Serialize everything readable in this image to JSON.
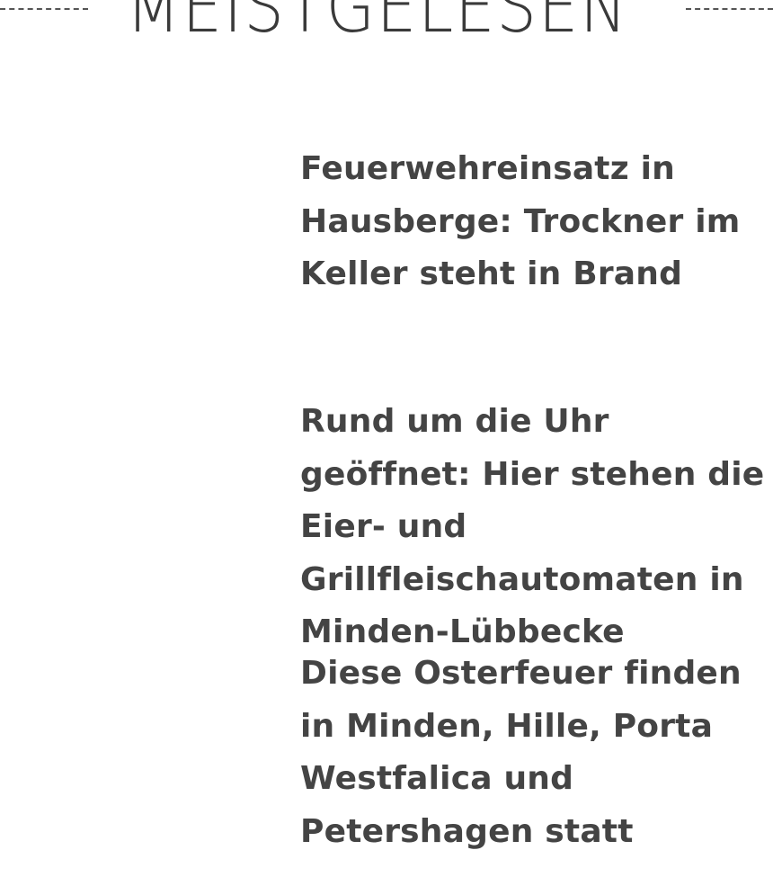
{
  "section": {
    "title": "MEISTGELESEN"
  },
  "articles": [
    {
      "title": "Feuerwehreinsatz in Hausberge: Trockner im Keller steht in Brand"
    },
    {
      "title": "Rund um die Uhr geöffnet: Hier stehen die Eier- und Grillfleischautomaten in Minden-Lübbecke"
    },
    {
      "title": "Diese Osterfeuer finden in Minden, Hille, Porta Westfalica und Petershagen statt"
    }
  ]
}
